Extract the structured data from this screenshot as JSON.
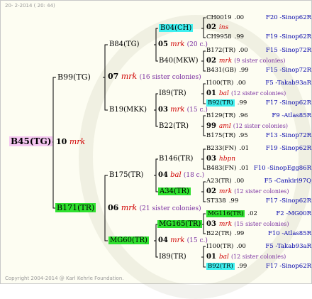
{
  "header_text": "20- 2-2014 ( 20: 44)",
  "footer_text": "Copyright 2004-2014 @ Karl Kehrle Foundation.",
  "root": "B45(TG)",
  "gen1": [
    {
      "id": "B99(TG)"
    },
    {
      "id": "B171(TR)"
    }
  ],
  "gen1_root_note": {
    "num": "10",
    "code": "mrk"
  },
  "gen2": [
    {
      "id": "B84(TG)"
    },
    {
      "id": "B19(MKK)"
    },
    {
      "id": "B175(TR)"
    },
    {
      "id": "MG60(TR)"
    }
  ],
  "gen2_notes": [
    {
      "num": "07",
      "code": "mrk",
      "extra": "(16 sister colonies)"
    },
    {
      "num": "06",
      "code": "mrk",
      "extra": "(21 sister colonies)"
    }
  ],
  "gen3": [
    {
      "id": "B04(CH)"
    },
    {
      "id": "B40(MKW)"
    },
    {
      "id": "I89(TR)"
    },
    {
      "id": "B22(TR)"
    },
    {
      "id": "B146(TR)"
    },
    {
      "id": "A34(TR)"
    },
    {
      "id": "MG165(TR)"
    },
    {
      "id": "I89(TR)"
    }
  ],
  "gen3_notes": [
    {
      "num": "05",
      "code": "mrk",
      "extra": "(20 c.)"
    },
    {
      "num": "03",
      "code": "mrk",
      "extra": "(15 c.)"
    },
    {
      "num": "04",
      "code": "bal",
      "extra": "(18 c.)"
    },
    {
      "num": "04",
      "code": "mrk",
      "extra": "(15 c.)"
    }
  ],
  "gen4": [
    {
      "id": "CH0019",
      "val": ".00",
      "ref": "F20 -Sinop62R"
    },
    {
      "num": "02",
      "code": "ins"
    },
    {
      "id": "CH9958",
      "val": ".99",
      "ref": "F19 -Sinop62R"
    },
    {
      "id": "B172(TR)",
      "val": ".00",
      "ref": "F15 -Sinop72R"
    },
    {
      "num": "02",
      "code": "mrk",
      "extra": "(9 sister colonies)"
    },
    {
      "id": "B431(GB)",
      "val": ".99",
      "ref": "F15 -Sinop72R"
    },
    {
      "id": "I100(TR)",
      "val": ".00",
      "ref": "F5 -Takab93aR"
    },
    {
      "num": "01",
      "code": "bal",
      "extra": "(12 sister colonies)"
    },
    {
      "id": "B92(TR)",
      "val": ".99",
      "ref": "F17 -Sinop62R"
    },
    {
      "id": "B129(TR)",
      "val": ".96",
      "ref": "F9 -Atlas85R"
    },
    {
      "num": "99",
      "code": "aml",
      "extra": "(12 sister colonies)"
    },
    {
      "id": "B175(TR)",
      "val": ".95",
      "ref": "F13 -Sinop72R"
    },
    {
      "id": "B233(FN)",
      "val": ".01",
      "ref": "F19 -Sinop62R"
    },
    {
      "num": "03",
      "code": "hbpn"
    },
    {
      "id": "B483(FN)",
      "val": ".01",
      "ref": "F10 -SinopEgg86R"
    },
    {
      "id": "A23(TR)",
      "val": ".00",
      "ref": "F5 -Cankiri97Q"
    },
    {
      "num": "02",
      "code": "mrk",
      "extra": "(12 sister colonies)"
    },
    {
      "id": "ST338",
      "val": ".99",
      "ref": "F17 -Sinop62R"
    },
    {
      "id": "MG116(TR)",
      "val": ".02",
      "ref": "F2 -MG00R"
    },
    {
      "num": "03",
      "code": "mrk",
      "extra": "(15 sister colonies)"
    },
    {
      "id": "B22(TR)",
      "val": ".99",
      "ref": "F10 -Atlas85R"
    },
    {
      "id": "I100(TR)",
      "val": ".00",
      "ref": "F5 -Takab93aR"
    },
    {
      "num": "01",
      "code": "bal",
      "extra": "(12 sister colonies)"
    },
    {
      "id": "B92(TR)",
      "val": ".99",
      "ref": "F17 -Sinop62R"
    }
  ],
  "colors": {
    "pink": "#f5c7f1",
    "green": "#2fe02f",
    "cyan": "#3ff0f0",
    "red": "#d00000",
    "purple": "#7a2ea0",
    "blue": "#0000aa"
  }
}
